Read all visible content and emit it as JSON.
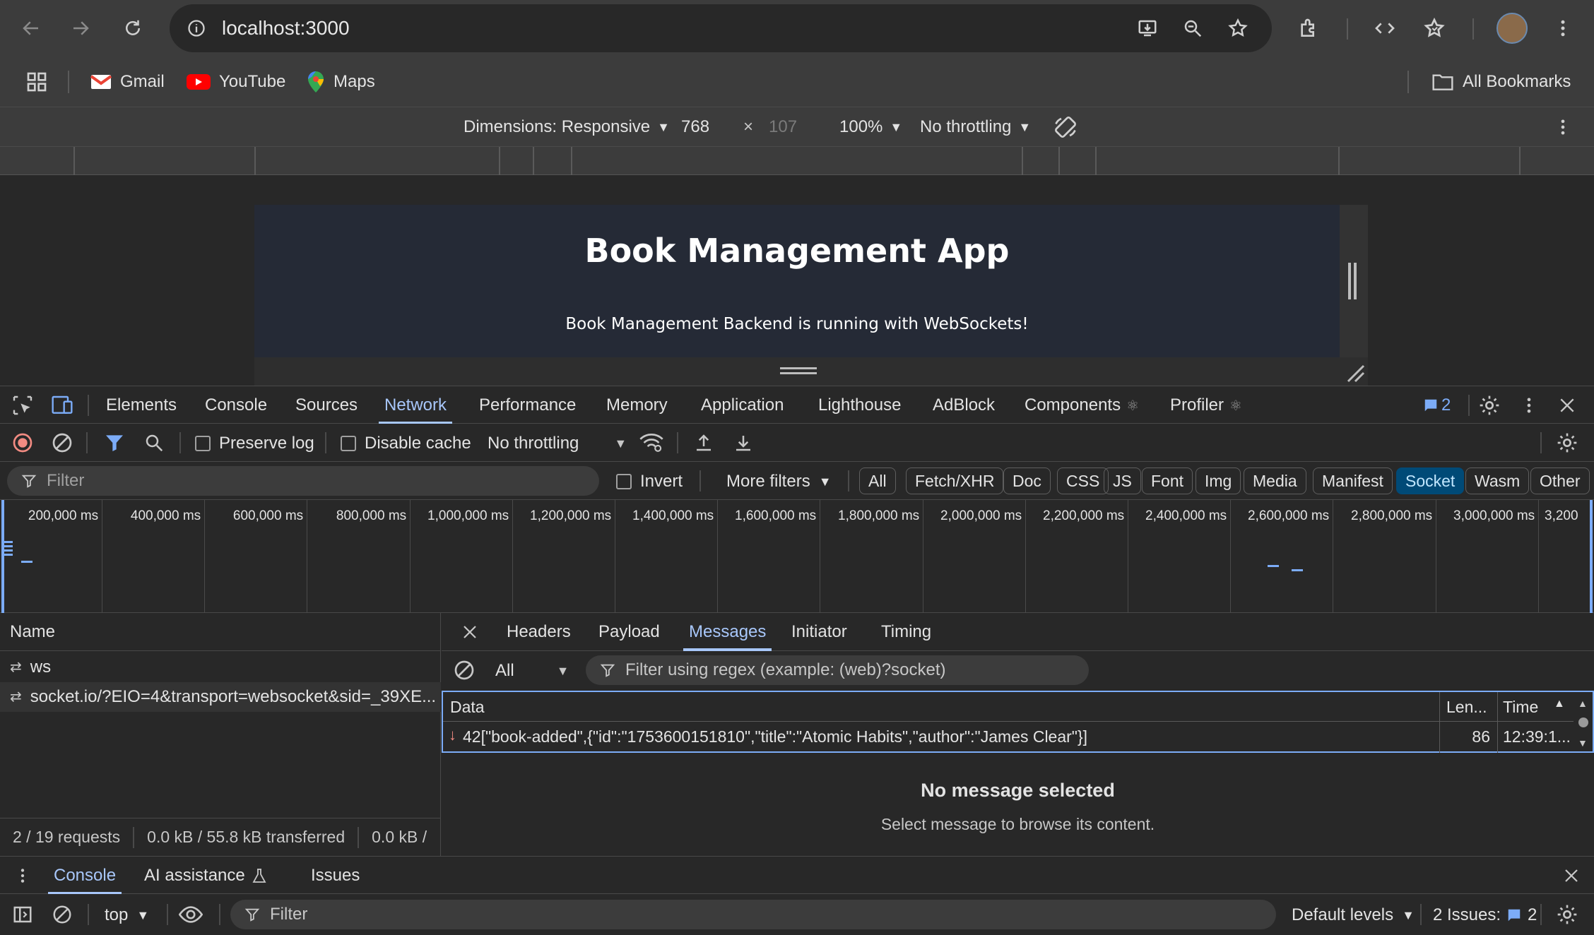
{
  "browser": {
    "url": "localhost:3000",
    "bookmarks": [
      {
        "label": "Gmail",
        "icon": "gmail-icon"
      },
      {
        "label": "YouTube",
        "icon": "youtube-icon"
      },
      {
        "label": "Maps",
        "icon": "maps-icon"
      }
    ],
    "all_bookmarks": "All Bookmarks"
  },
  "device_toolbar": {
    "dimensions": "Dimensions: Responsive",
    "width": "768",
    "times": "×",
    "height": "107",
    "zoom": "100%",
    "throttling": "No throttling"
  },
  "page": {
    "title": "Book Management App",
    "subtitle": "Book Management Backend is running with WebSockets!"
  },
  "devtools": {
    "tabs": [
      "Elements",
      "Console",
      "Sources",
      "Network",
      "Performance",
      "Memory",
      "Application",
      "Lighthouse",
      "AdBlock",
      "Components",
      "Profiler"
    ],
    "active_tab": "Network",
    "issues_badge": "2",
    "network_toolbar": {
      "preserve_log": "Preserve log",
      "disable_cache": "Disable cache",
      "throttling": "No throttling"
    },
    "filter": {
      "placeholder": "Filter",
      "invert": "Invert",
      "more_filters": "More filters",
      "types": [
        "All",
        "Fetch/XHR",
        "Doc",
        "CSS",
        "JS",
        "Font",
        "Img",
        "Media",
        "Manifest",
        "Socket",
        "Wasm",
        "Other"
      ],
      "active_type": "Socket"
    },
    "overview_ticks": [
      "200,000 ms",
      "400,000 ms",
      "600,000 ms",
      "800,000 ms",
      "1,000,000 ms",
      "1,200,000 ms",
      "1,400,000 ms",
      "1,600,000 ms",
      "1,800,000 ms",
      "2,000,000 ms",
      "2,200,000 ms",
      "2,400,000 ms",
      "2,600,000 ms",
      "2,800,000 ms",
      "3,000,000 ms",
      "3,200"
    ],
    "requests": {
      "header": "Name",
      "items": [
        {
          "name": "ws"
        },
        {
          "name": "socket.io/?EIO=4&transport=websocket&sid=_39XE..."
        }
      ],
      "summary": [
        "2 / 19 requests",
        "0.0 kB / 55.8 kB transferred",
        "0.0 kB /"
      ]
    },
    "detail": {
      "tabs": [
        "Headers",
        "Payload",
        "Messages",
        "Initiator",
        "Timing"
      ],
      "active_tab": "Messages",
      "msg_filter_select": "All",
      "msg_filter_placeholder": "Filter using regex (example: (web)?socket)",
      "columns": [
        "Data",
        "Len...",
        "Time"
      ],
      "messages": [
        {
          "data": "42[\"book-added\",{\"id\":\"1753600151810\",\"title\":\"Atomic Habits\",\"author\":\"James Clear\"}]",
          "length": "86",
          "time": "12:39:1..."
        }
      ],
      "empty_title": "No message selected",
      "empty_hint": "Select message to browse its content."
    },
    "drawer": {
      "tabs": [
        "Console",
        "AI assistance",
        "Issues"
      ],
      "active_tab": "Console",
      "context": "top",
      "filter_placeholder": "Filter",
      "levels": "Default levels",
      "issues_label": "2 Issues:",
      "issues_count": "2"
    }
  },
  "colors": {
    "accent": "#a8c7fa",
    "active_pill_bg": "#004a77",
    "record_red": "#f28b82",
    "page_bg": "#252a36"
  }
}
